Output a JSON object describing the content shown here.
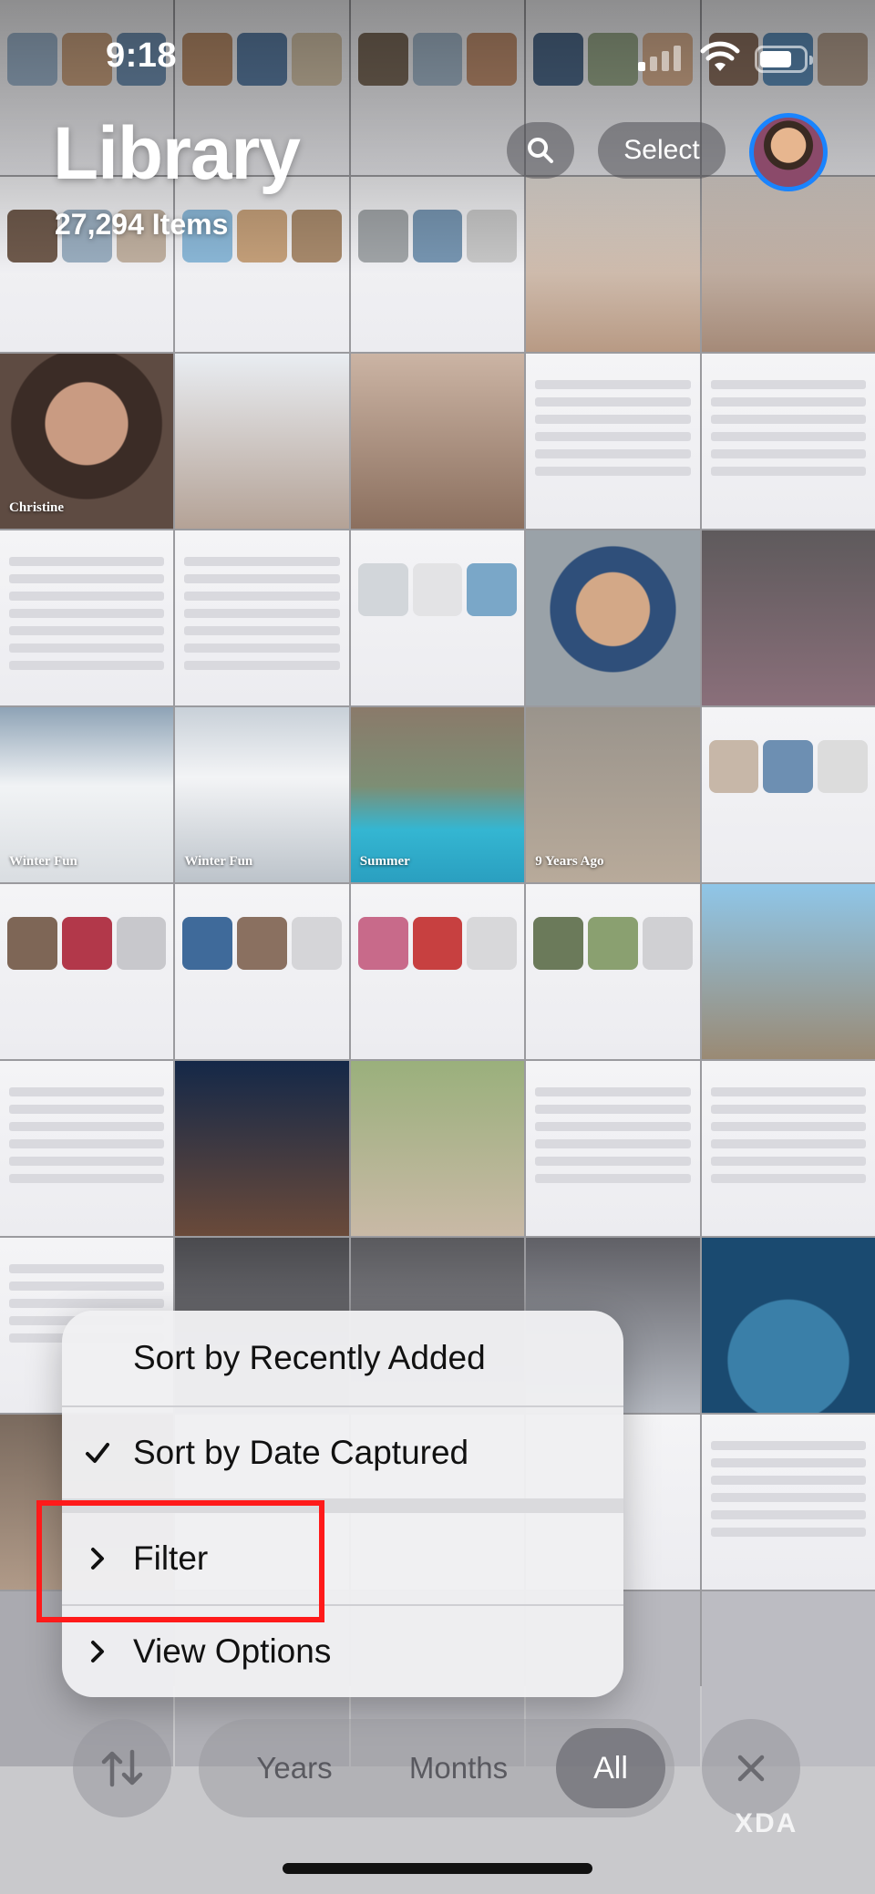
{
  "status_bar": {
    "time": "9:18"
  },
  "header": {
    "title": "Library",
    "subtitle": "27,294 Items",
    "select_label": "Select"
  },
  "grid_captions": [
    {
      "text": "Christine"
    },
    {
      "text": "Winter Fun"
    },
    {
      "text": "Winter Fun"
    },
    {
      "text": "Summer"
    },
    {
      "text": "9 Years Ago"
    }
  ],
  "sort_menu": {
    "items": [
      {
        "label": "Sort by Recently Added",
        "checked": false,
        "submenu": false
      },
      {
        "label": "Sort by Date Captured",
        "checked": true,
        "submenu": false
      },
      {
        "label": "Filter",
        "checked": false,
        "submenu": true,
        "highlighted": true
      },
      {
        "label": "View Options",
        "checked": false,
        "submenu": true
      }
    ]
  },
  "toolbar": {
    "segments": [
      "Years",
      "Months",
      "All"
    ],
    "selected_segment": "All"
  },
  "watermark": "XDA",
  "colors": {
    "accent": "#1a84ff",
    "highlight_box": "#ff1a1a"
  }
}
